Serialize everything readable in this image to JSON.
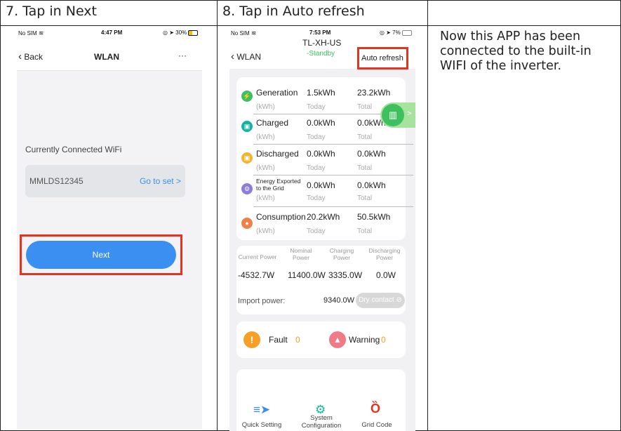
{
  "table": {
    "col1_header": "7. Tap in Next",
    "col2_header": "8. Tap in Auto refresh",
    "col3_note": "Now this APP has been connected to the built-in WIFI of the inverter."
  },
  "phone1": {
    "status": {
      "carrier": "No SIM",
      "time": "4:47 PM",
      "battery": "30%"
    },
    "nav": {
      "back": "Back",
      "title": "WLAN",
      "more": "···"
    },
    "wifi_label": "Currently Connected WiFi",
    "wifi_name": "MMLDS12345",
    "go_to_set": "Go to set >",
    "next_button": "Next"
  },
  "phone2": {
    "status": {
      "carrier": "No SIM",
      "time": "7:53 PM",
      "battery": "7%"
    },
    "nav": {
      "back": "WLAN",
      "title": "TL-XH-US",
      "subtitle": "-Standby",
      "auto_refresh": "Auto refresh"
    },
    "energy_rows": [
      {
        "label": "Generation",
        "unit": "(kWh)",
        "today": "1.5kWh",
        "total": "23.2kWh",
        "color": "#3ec05e"
      },
      {
        "label": "Charged",
        "unit": "(kWh)",
        "today": "0.0kWh",
        "total": "0.0kWh",
        "color": "#13b5a0"
      },
      {
        "label": "Discharged",
        "unit": "(kWh)",
        "today": "0.0kWh",
        "total": "0.0kWh",
        "color": "#f2b530"
      },
      {
        "label": "Energy Exported to the Grid",
        "unit": "(kWh)",
        "today": "0.0kWh",
        "total": "0.0kWh",
        "color": "#8c7be0"
      },
      {
        "label": "Consumption",
        "unit": "(kWh)",
        "today": "20.2kWh",
        "total": "50.5kWh",
        "color": "#f07f4a"
      }
    ],
    "today_label": "Today",
    "total_label": "Total",
    "power_headers": [
      "Current Power",
      "Nominal Power",
      "Charging Power",
      "Discharging Power"
    ],
    "power_values": [
      "-4532.7W",
      "11400.0W",
      "3335.0W",
      "0.0W"
    ],
    "import_label": "Import power:",
    "import_value": "9340.0W",
    "dry_contact": "Dry contact",
    "fault_label": "Fault",
    "fault_value": "0",
    "warning_label": "Warning",
    "warning_value": "0",
    "bottom_items": [
      "Quick Setting",
      "System Configuration",
      "Grid Code"
    ]
  }
}
